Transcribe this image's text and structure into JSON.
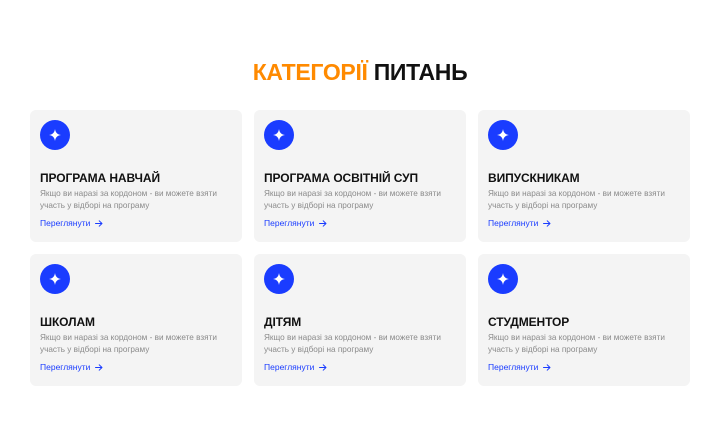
{
  "heading": {
    "accent": "КАТЕГОРІЇ",
    "main": "ПИТАНЬ"
  },
  "colors": {
    "accent": "#ff8a00",
    "brand": "#1a3cff",
    "card_bg": "#f4f4f4"
  },
  "cards": [
    {
      "icon": "sparkle-icon",
      "title": "ПРОГРАМА НАВЧАЙ",
      "description": "Якщо ви наразі за кордоном - ви можете взяти участь у відборі на програму",
      "link": "Переглянути"
    },
    {
      "icon": "sparkle-icon",
      "title": "ПРОГРАМА ОСВІТНІЙ СУП",
      "description": "Якщо ви наразі за кордоном - ви можете взяти участь у відборі на програму",
      "link": "Переглянути"
    },
    {
      "icon": "sparkle-icon",
      "title": "ВИПУСКНИКАМ",
      "description": "Якщо ви наразі за кордоном - ви можете взяти участь у відборі на програму",
      "link": "Переглянути"
    },
    {
      "icon": "sparkle-icon",
      "title": "ШКОЛАМ",
      "description": "Якщо ви наразі за кордоном - ви можете взяти участь у відборі на програму",
      "link": "Переглянути"
    },
    {
      "icon": "sparkle-icon",
      "title": "ДІТЯМ",
      "description": "Якщо ви наразі за кордоном - ви можете взяти участь у відборі на програму",
      "link": "Переглянути"
    },
    {
      "icon": "sparkle-icon",
      "title": "СТУДМЕНТОР",
      "description": "Якщо ви наразі за кордоном - ви можете взяти участь у відборі на програму",
      "link": "Переглянути"
    }
  ]
}
